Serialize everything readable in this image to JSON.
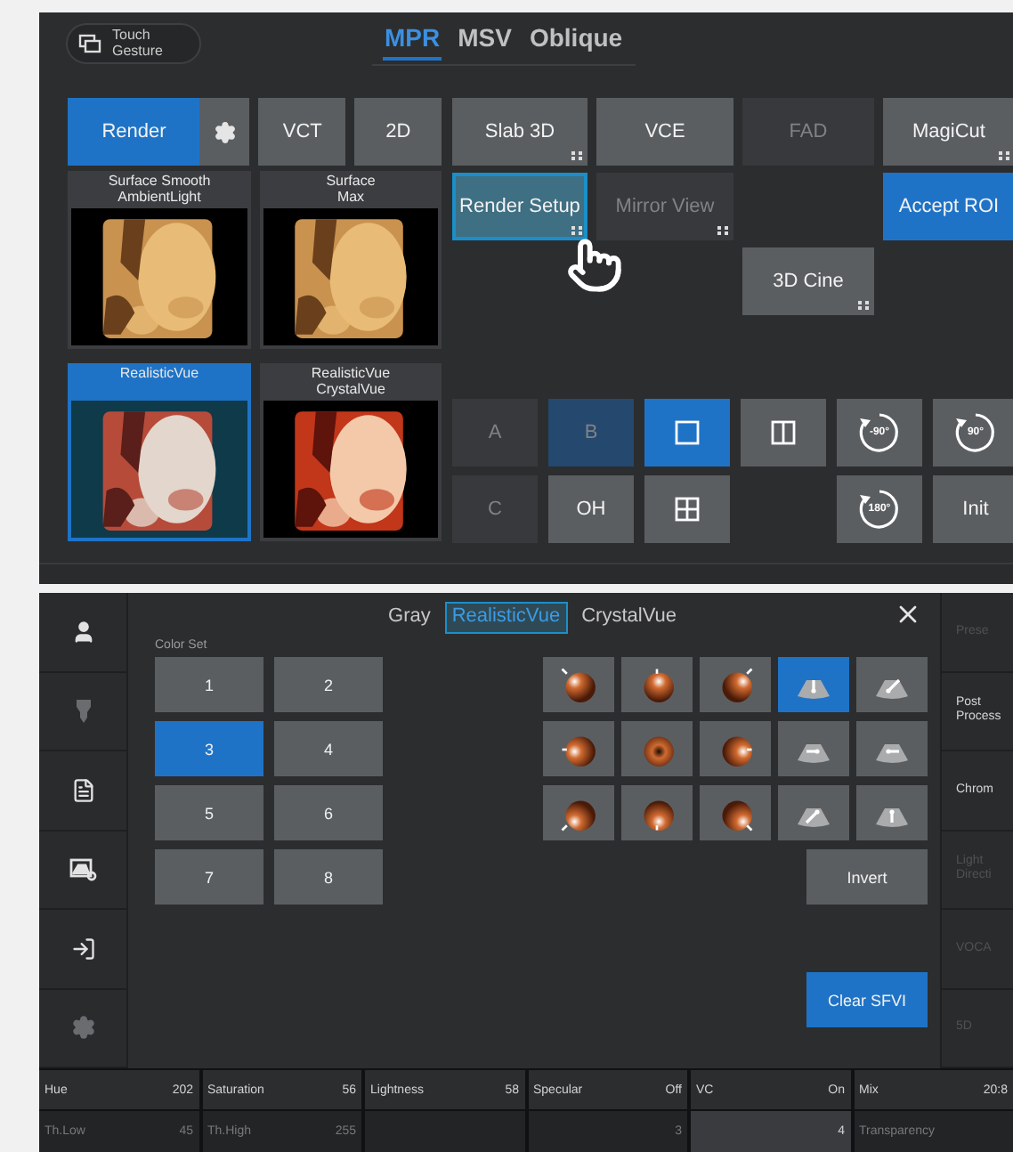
{
  "top_panel": {
    "gesture_button": {
      "label": "Touch\nGesture"
    },
    "tabs": [
      {
        "label": "MPR",
        "selected": true
      },
      {
        "label": "MSV",
        "selected": false
      },
      {
        "label": "Oblique",
        "selected": false
      }
    ],
    "mode_buttons": [
      {
        "label": "Render",
        "selected": true,
        "settings": true
      },
      {
        "label": "VCT",
        "selected": false,
        "settings": false
      },
      {
        "label": "2D",
        "selected": false,
        "settings": false
      }
    ],
    "thumbnails": [
      {
        "label": "Surface Smooth\nAmbientLight",
        "selected": false
      },
      {
        "label": "Surface\nMax",
        "selected": false
      },
      {
        "label": "RealisticVue",
        "selected": true
      },
      {
        "label": "RealisticVue\nCrystalVue",
        "selected": false
      }
    ],
    "tool_rows": [
      [
        {
          "kind": "button",
          "label": "Slab 3D",
          "disabled": false,
          "selected": false,
          "focused": false,
          "submenu": true
        },
        {
          "kind": "button",
          "label": "VCE",
          "disabled": false,
          "selected": false,
          "focused": false,
          "submenu": false
        },
        {
          "kind": "button",
          "label": "FAD",
          "disabled": true,
          "selected": false,
          "focused": false,
          "submenu": false
        },
        {
          "kind": "button",
          "label": "MagiCut",
          "disabled": false,
          "selected": false,
          "focused": false,
          "submenu": true
        }
      ],
      [
        {
          "kind": "button",
          "label": "Render Setup",
          "disabled": false,
          "selected": false,
          "focused": true,
          "submenu": true
        },
        {
          "kind": "button",
          "label": "Mirror View",
          "disabled": true,
          "selected": false,
          "focused": false,
          "submenu": true
        },
        {
          "kind": "blank"
        },
        {
          "kind": "button",
          "label": "Accept ROI",
          "disabled": false,
          "selected": true,
          "focused": false,
          "submenu": false
        }
      ],
      [
        {
          "kind": "blank"
        },
        {
          "kind": "blank"
        },
        {
          "kind": "button",
          "label": "3D Cine",
          "disabled": false,
          "selected": false,
          "focused": false,
          "submenu": true
        },
        {
          "kind": "blank"
        }
      ]
    ],
    "view_buttons": [
      [
        {
          "kind": "text",
          "label": "A",
          "disabled": true,
          "selected": false
        },
        {
          "kind": "text",
          "label": "B",
          "disabled": true,
          "selected": true
        },
        {
          "kind": "single",
          "disabled": false,
          "selected": true
        },
        {
          "kind": "dual",
          "disabled": false,
          "selected": false
        },
        {
          "kind": "rotate",
          "label": "-90°",
          "disabled": false,
          "selected": false
        },
        {
          "kind": "rotate",
          "label": "90°",
          "disabled": false,
          "selected": false
        }
      ],
      [
        {
          "kind": "text",
          "label": "C",
          "disabled": true,
          "selected": false
        },
        {
          "kind": "text",
          "label": "OH",
          "disabled": false,
          "selected": false
        },
        {
          "kind": "quad",
          "disabled": false,
          "selected": false
        },
        {
          "kind": "blank"
        },
        {
          "kind": "rotate",
          "label": "180°",
          "disabled": false,
          "selected": false
        },
        {
          "kind": "text",
          "label": "Init",
          "disabled": false,
          "selected": false
        }
      ]
    ]
  },
  "bottom_panel": {
    "sidebar": [
      {
        "kind": "user",
        "disabled": false
      },
      {
        "kind": "probe",
        "disabled": true
      },
      {
        "kind": "document",
        "disabled": false
      },
      {
        "kind": "image_search",
        "disabled": false
      },
      {
        "kind": "enter",
        "disabled": false
      },
      {
        "kind": "settings",
        "disabled": true
      }
    ],
    "tabs": [
      {
        "label": "Gray",
        "selected": false
      },
      {
        "label": "RealisticVue",
        "selected": true
      },
      {
        "label": "CrystalVue",
        "selected": false
      }
    ],
    "color_set": {
      "title": "Color Set",
      "options": [
        {
          "label": "1",
          "selected": false
        },
        {
          "label": "2",
          "selected": false
        },
        {
          "label": "3",
          "selected": true
        },
        {
          "label": "4",
          "selected": false
        },
        {
          "label": "5",
          "selected": false
        },
        {
          "label": "6",
          "selected": false
        },
        {
          "label": "7",
          "selected": false
        },
        {
          "label": "8",
          "selected": false
        }
      ]
    },
    "light_buttons": [
      {
        "kind": "sphere",
        "selected": false
      },
      {
        "kind": "sphere",
        "selected": false
      },
      {
        "kind": "sphere",
        "selected": false
      },
      {
        "kind": "fan",
        "selected": true
      },
      {
        "kind": "fan",
        "selected": false
      },
      {
        "kind": "sphere",
        "selected": false
      },
      {
        "kind": "sphere",
        "selected": false
      },
      {
        "kind": "sphere",
        "selected": false
      },
      {
        "kind": "fan",
        "selected": false
      },
      {
        "kind": "fan",
        "selected": false
      },
      {
        "kind": "sphere",
        "selected": false
      },
      {
        "kind": "sphere",
        "selected": false
      },
      {
        "kind": "sphere",
        "selected": false
      },
      {
        "kind": "fan",
        "selected": false
      },
      {
        "kind": "fan",
        "selected": false
      }
    ],
    "invert_button": {
      "label": "Invert"
    },
    "clear_button": {
      "label": "Clear SFVI"
    },
    "side_menu": [
      {
        "label": "Prese",
        "disabled": true
      },
      {
        "label": "Post\nProcess",
        "disabled": false
      },
      {
        "label": "Chrom",
        "disabled": false
      },
      {
        "label": "Light\nDirecti",
        "disabled": true
      },
      {
        "label": "VOCA",
        "disabled": true
      },
      {
        "label": "5D",
        "disabled": true
      }
    ],
    "parameters": [
      [
        {
          "label": "Hue",
          "value": "202",
          "highlighted": false,
          "disabled": false
        },
        {
          "label": "Saturation",
          "value": "56",
          "highlighted": false,
          "disabled": false
        },
        {
          "label": "Lightness",
          "value": "58",
          "highlighted": false,
          "disabled": false
        },
        {
          "label": "Specular",
          "value": "Off",
          "highlighted": false,
          "disabled": false
        },
        {
          "label": "VC",
          "value": "On",
          "highlighted": false,
          "disabled": false
        },
        {
          "label": "Mix",
          "value": "20:8",
          "highlighted": false,
          "disabled": false
        }
      ],
      [
        {
          "label": "Th.Low",
          "value": "45",
          "highlighted": false,
          "disabled": true
        },
        {
          "label": "Th.High",
          "value": "255",
          "highlighted": false,
          "disabled": true
        },
        {
          "highlighted": false
        },
        {
          "value": "3",
          "highlighted": false,
          "disabled": true
        },
        {
          "value": "4",
          "highlighted": true,
          "disabled": false
        },
        {
          "label": "Transparency",
          "highlighted": false,
          "disabled": true
        }
      ]
    ]
  }
}
